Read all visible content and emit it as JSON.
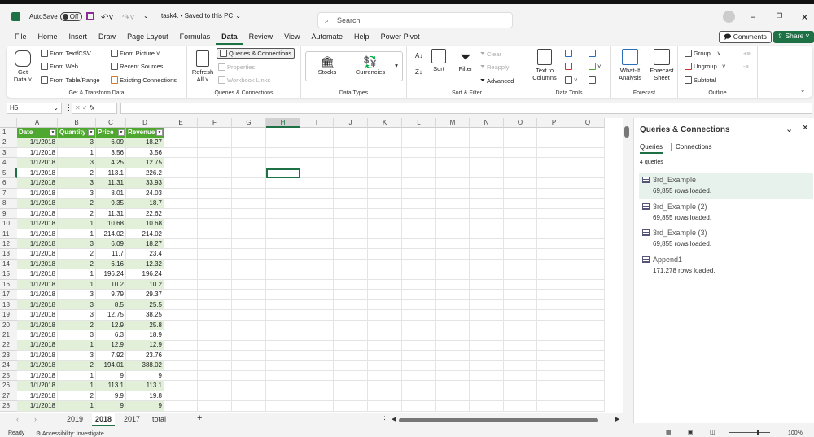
{
  "titlebar": {
    "autosave": "AutoSave",
    "toggle": "Off",
    "filename": "task4. • Saved to this PC",
    "search_placeholder": "Search"
  },
  "tabs": [
    "File",
    "Home",
    "Insert",
    "Draw",
    "Page Layout",
    "Formulas",
    "Data",
    "Review",
    "View",
    "Automate",
    "Help",
    "Power Pivot"
  ],
  "active_tab": "Data",
  "actions": {
    "comments": "Comments",
    "share": "Share"
  },
  "ribbon": {
    "get_transform": {
      "label": "Get & Transform Data",
      "get_data": "Get Data",
      "from_text": "From Text/CSV",
      "from_web": "From Web",
      "from_table": "From Table/Range",
      "from_picture": "From Picture",
      "recent": "Recent Sources",
      "existing": "Existing Connections"
    },
    "queries": {
      "label": "Queries & Connections",
      "refresh": "Refresh All",
      "qc": "Queries & Connections",
      "properties": "Properties",
      "links": "Workbook Links"
    },
    "types": {
      "label": "Data Types",
      "stocks": "Stocks",
      "currencies": "Currencies"
    },
    "sort": {
      "label": "Sort & Filter",
      "sort": "Sort",
      "filter": "Filter",
      "clear": "Clear",
      "reapply": "Reapply",
      "advanced": "Advanced"
    },
    "tools": {
      "label": "Data Tools",
      "ttc": "Text to Columns"
    },
    "forecast": {
      "label": "Forecast",
      "whatif": "What-If Analysis",
      "sheet": "Forecast Sheet"
    },
    "outline": {
      "label": "Outline",
      "group": "Group",
      "ungroup": "Ungroup",
      "subtotal": "Subtotal"
    }
  },
  "formula": {
    "namebox": "H5",
    "fx": "fx",
    "value": ""
  },
  "columns": [
    "A",
    "B",
    "C",
    "D",
    "E",
    "F",
    "G",
    "H",
    "I",
    "J",
    "K",
    "L",
    "M",
    "N",
    "O",
    "P",
    "Q"
  ],
  "selected_cell": "H5",
  "table": {
    "headers": [
      "Date",
      "Quantity",
      "Price",
      "Revenue"
    ],
    "rows": [
      [
        "1/1/2018",
        "3",
        "6.09",
        "18.27"
      ],
      [
        "1/1/2018",
        "1",
        "3.56",
        "3.56"
      ],
      [
        "1/1/2018",
        "3",
        "4.25",
        "12.75"
      ],
      [
        "1/1/2018",
        "2",
        "113.1",
        "226.2"
      ],
      [
        "1/1/2018",
        "3",
        "11.31",
        "33.93"
      ],
      [
        "1/1/2018",
        "3",
        "8.01",
        "24.03"
      ],
      [
        "1/1/2018",
        "2",
        "9.35",
        "18.7"
      ],
      [
        "1/1/2018",
        "2",
        "11.31",
        "22.62"
      ],
      [
        "1/1/2018",
        "1",
        "10.68",
        "10.68"
      ],
      [
        "1/1/2018",
        "1",
        "214.02",
        "214.02"
      ],
      [
        "1/1/2018",
        "3",
        "6.09",
        "18.27"
      ],
      [
        "1/1/2018",
        "2",
        "11.7",
        "23.4"
      ],
      [
        "1/1/2018",
        "2",
        "6.16",
        "12.32"
      ],
      [
        "1/1/2018",
        "1",
        "196.24",
        "196.24"
      ],
      [
        "1/1/2018",
        "1",
        "10.2",
        "10.2"
      ],
      [
        "1/1/2018",
        "3",
        "9.79",
        "29.37"
      ],
      [
        "1/1/2018",
        "3",
        "8.5",
        "25.5"
      ],
      [
        "1/1/2018",
        "3",
        "12.75",
        "38.25"
      ],
      [
        "1/1/2018",
        "2",
        "12.9",
        "25.8"
      ],
      [
        "1/1/2018",
        "3",
        "6.3",
        "18.9"
      ],
      [
        "1/1/2018",
        "1",
        "12.9",
        "12.9"
      ],
      [
        "1/1/2018",
        "3",
        "7.92",
        "23.76"
      ],
      [
        "1/1/2018",
        "2",
        "194.01",
        "388.02"
      ],
      [
        "1/1/2018",
        "1",
        "9",
        "9"
      ],
      [
        "1/1/2018",
        "1",
        "113.1",
        "113.1"
      ],
      [
        "1/1/2018",
        "2",
        "9.9",
        "19.8"
      ],
      [
        "1/1/2018",
        "1",
        "9",
        "9"
      ]
    ]
  },
  "panel": {
    "title": "Queries & Connections",
    "tab_queries": "Queries",
    "tab_connections": "Connections",
    "count": "4 queries",
    "queries": [
      {
        "name": "3rd_Example",
        "status": "69,855 rows loaded."
      },
      {
        "name": "3rd_Example (2)",
        "status": "69,855 rows loaded."
      },
      {
        "name": "3rd_Example (3)",
        "status": "69,855 rows loaded."
      },
      {
        "name": "Append1",
        "status": "171,278 rows loaded."
      }
    ]
  },
  "sheets": [
    "2019",
    "2018",
    "2017",
    "total"
  ],
  "active_sheet": "2018",
  "status": {
    "ready": "Ready",
    "accessibility": "Accessibility: Investigate",
    "zoom": "100%"
  },
  "colors": {
    "accent": "#1e7145",
    "table_header": "#4ea72e",
    "band": "#e2f0d9"
  }
}
